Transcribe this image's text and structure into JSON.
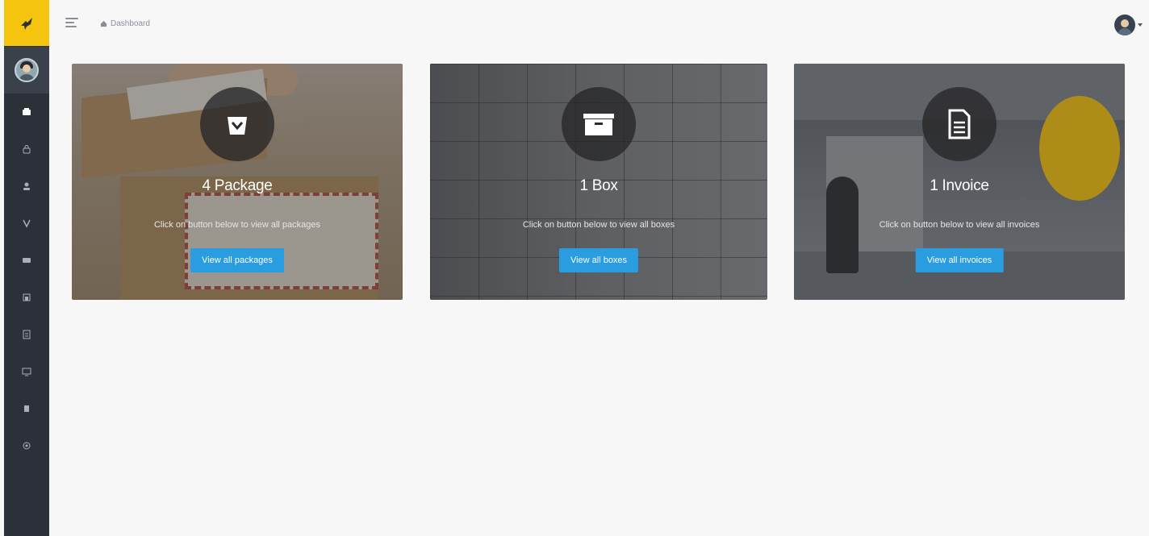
{
  "sidebar": {
    "logo_icon": "logo-icon",
    "avatar_icon": "user-avatar",
    "items": [
      {
        "icon": "box-icon",
        "active": true
      },
      {
        "icon": "lock-icon",
        "active": false
      },
      {
        "icon": "user-icon",
        "active": false
      },
      {
        "icon": "package-icon",
        "active": false
      },
      {
        "icon": "mail-icon",
        "active": false
      },
      {
        "icon": "store-icon",
        "active": false
      },
      {
        "icon": "report-icon",
        "active": false
      },
      {
        "icon": "monitor-icon",
        "active": false
      },
      {
        "icon": "note-icon",
        "active": false
      },
      {
        "icon": "settings-icon",
        "active": false
      }
    ]
  },
  "topbar": {
    "breadcrumb": "Dashboard"
  },
  "cards": [
    {
      "title": "4 Package",
      "description": "Click on button below to view all packages",
      "button": "View all packages",
      "icon": "bag-icon"
    },
    {
      "title": "1 Box",
      "description": "Click on button below to view all boxes",
      "button": "View all boxes",
      "icon": "box-icon"
    },
    {
      "title": "1 Invoice",
      "description": "Click on button below to view all invoices",
      "button": "View all invoices",
      "icon": "document-icon"
    }
  ],
  "colors": {
    "accent": "#2a9ce0",
    "brand": "#f5c40f",
    "sidebar": "#2b3039"
  }
}
